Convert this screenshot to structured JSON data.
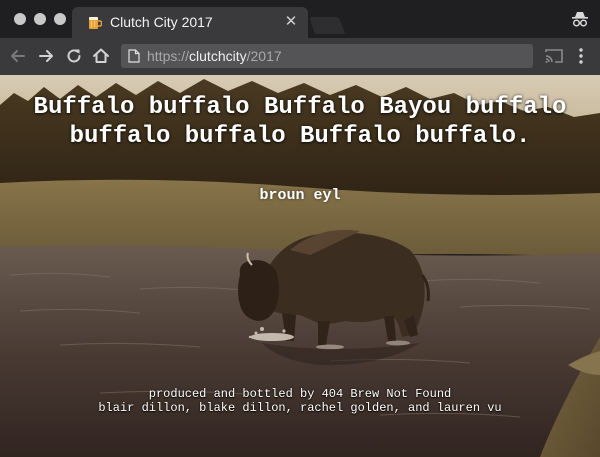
{
  "browser": {
    "tab": {
      "title": "Clutch City 2017",
      "favicon": "beer-mug-icon",
      "close_icon": "close-icon"
    },
    "toolbar": {
      "url_scheme": "https://",
      "url_host": "clutchcity",
      "url_path": "/2017",
      "icons": [
        "arrow-left-icon",
        "arrow-right-icon",
        "reload-icon",
        "home-icon",
        "page-icon",
        "cast-icon",
        "more-vertical-icon",
        "incognito-icon"
      ]
    }
  },
  "page": {
    "headline": "Buffalo buffalo Buffalo Bayou buffalo buffalo buffalo Buffalo buffalo.",
    "subtitle": "broun eyl",
    "credits_line1": "produced and bottled by 404 Brew Not Found",
    "credits_line2": "blair dillon, blake dillon, rachel golden, and lauren vu",
    "background": "bison-wading-river-photo"
  },
  "colors": {
    "chrome_dark": "#1f1f21",
    "toolbar": "#3a3a3c",
    "omnibox": "#545456",
    "text_white": "#ffffff"
  }
}
